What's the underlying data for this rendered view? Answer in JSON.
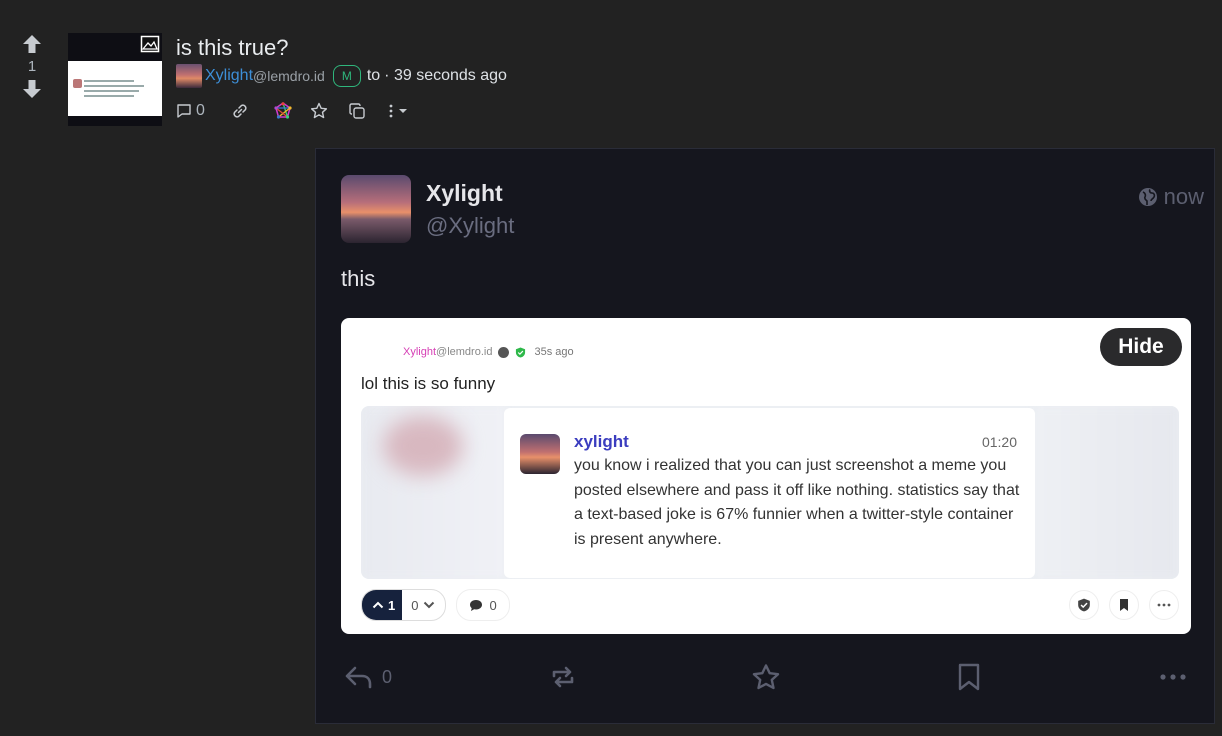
{
  "post": {
    "score": "1",
    "title": "is this true?",
    "author_name": "Xylight",
    "author_instance": "@lemdro.id",
    "mod_badge": "M",
    "to_label": "to",
    "time": "· 39 seconds ago",
    "comment_count": "0"
  },
  "tweet": {
    "name": "Xylight",
    "handle": "@Xylight",
    "time": "now",
    "text": "this",
    "reply_count": "0",
    "card": {
      "hide_label": "Hide",
      "author_name": "Xylight",
      "author_instance": "@lemdro.id",
      "time": "35s ago",
      "body": "lol this is so funny",
      "upvotes": "1",
      "downvotes": "0",
      "comments": "0",
      "inner": {
        "name": "xylight",
        "time": "01:20",
        "text": "you know i realized that you can just screenshot a meme you posted elsewhere and pass it off like nothing. statistics say that a text-based joke is 67% funnier when a twitter-style container is present anywhere."
      }
    }
  },
  "colors": {
    "page_bg": "#222222",
    "link": "#3d8fd8",
    "mod_green": "#2fb67c",
    "embed_bg": "#15161e",
    "card_user": "#d63fb5",
    "inner_name": "#3b3dbf"
  }
}
